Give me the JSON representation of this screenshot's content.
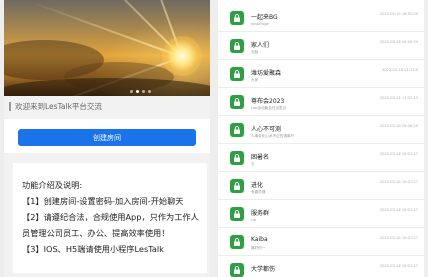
{
  "banner": {
    "dots": 4,
    "active_dot": 1
  },
  "notice": {
    "text": "欢迎来到LesTalk平台交流"
  },
  "create_button": {
    "label": "创建房间"
  },
  "intro": {
    "lines": [
      "功能介绍及说明:",
      "【1】创建房间-设置密码-加入房间-开始聊天",
      "【2】请遵纪合法，合规使用App，只作为工作人",
      "员管理公司员工、办公、提高效率使用！",
      "【3】IOS、H5端请使用小程序LesTalk"
    ]
  },
  "rooms": [
    {
      "name": "一起来BG",
      "sub": "yin&fruge",
      "time": "2023-05-19 18:52:09"
    },
    {
      "name": "家人们",
      "sub": "无脑",
      "time": "2023-03-18 00:09:54"
    },
    {
      "name": "潍坊爱聚森",
      "sub": "大家",
      "time": "2023-03-16 11:12:0"
    },
    {
      "name": "尊布会2023",
      "sub": "Lab活动聚会在这里见",
      "time": "2023-03-15 17:37:53"
    },
    {
      "name": "人心不可测",
      "sub": "人事变化心术不正的请离开",
      "time": "2023-03-16 20:06:29"
    },
    {
      "name": "困暑名",
      "sub": "无",
      "time": "2023-03-16 10:07:27"
    },
    {
      "name": "进化",
      "sub": "有趣灵魂",
      "time": "2023-03-16 10:07:27"
    },
    {
      "name": "服务群",
      "sub": "cip",
      "time": "2023-03-16 10:07:27"
    },
    {
      "name": "Kaiba",
      "sub": "最好的一",
      "time": "2023-03-16 10:07:27"
    },
    {
      "name": "大学都伤",
      "sub": "",
      "time": "2023-03-16 10:07:27"
    }
  ],
  "colors": {
    "accent": "#1a73e8",
    "avatar": "#2e9f45"
  },
  "icons": {
    "room_avatar": "lock-icon"
  }
}
